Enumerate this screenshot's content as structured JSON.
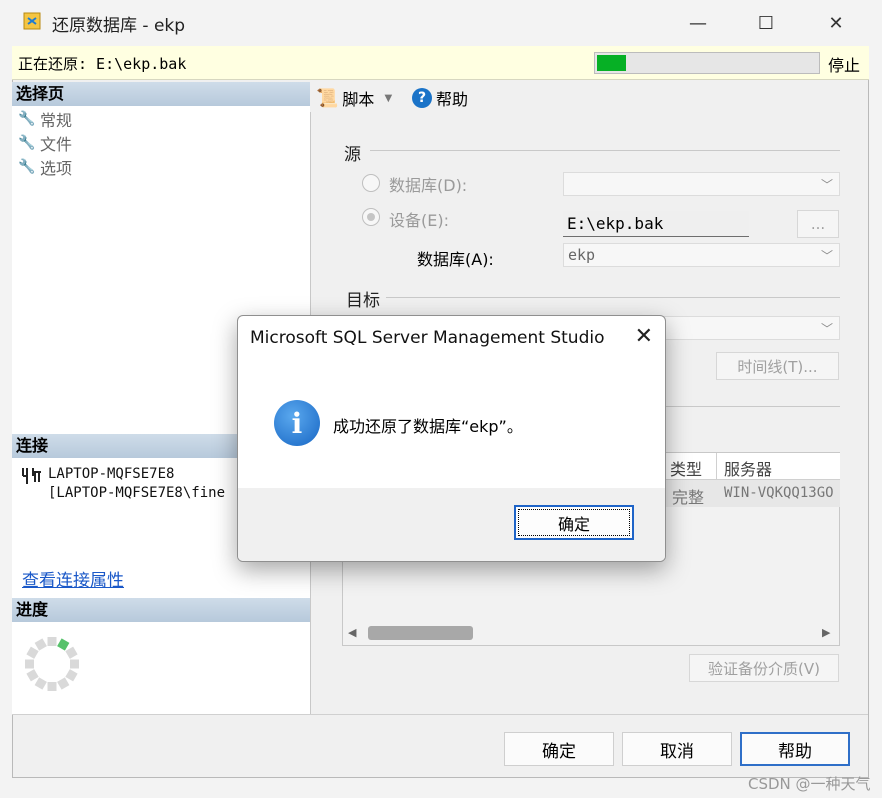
{
  "window": {
    "title": "还原数据库 - ekp"
  },
  "status": {
    "text": "正在还原: E:\\ekp.bak",
    "progress_percent": 14,
    "stop_label": "停止"
  },
  "left": {
    "select_page_header": "选择页",
    "pages": [
      "常规",
      "文件",
      "选项"
    ],
    "connection_header": "连接",
    "connection_server": "LAPTOP-MQFSE7E8",
    "connection_user": "[LAPTOP-MQFSE7E8\\fine",
    "connection_link": "查看连接属性",
    "progress_header": "进度"
  },
  "toolbar": {
    "script_label": "脚本",
    "help_label": "帮助"
  },
  "source": {
    "title": "源",
    "database_radio": "数据库(D):",
    "device_radio": "设备(E):",
    "device_value": "E:\\ekp.bak",
    "browse_label": "...",
    "database_label": "数据库(A):",
    "database_value": "ekp"
  },
  "target": {
    "title": "目标",
    "timeline_button": "时间线(T)..."
  },
  "grid": {
    "headers": [
      "类型",
      "服务器"
    ],
    "row": [
      "完整",
      "WIN-VQKQQ13GO"
    ]
  },
  "verify_button": "验证备份介质(V)",
  "buttons": {
    "ok": "确定",
    "cancel": "取消",
    "help": "帮助"
  },
  "modal": {
    "title": "Microsoft SQL Server Management Studio",
    "message": "成功还原了数据库“ekp”。",
    "ok": "确定"
  },
  "watermark": "CSDN @一种天气"
}
